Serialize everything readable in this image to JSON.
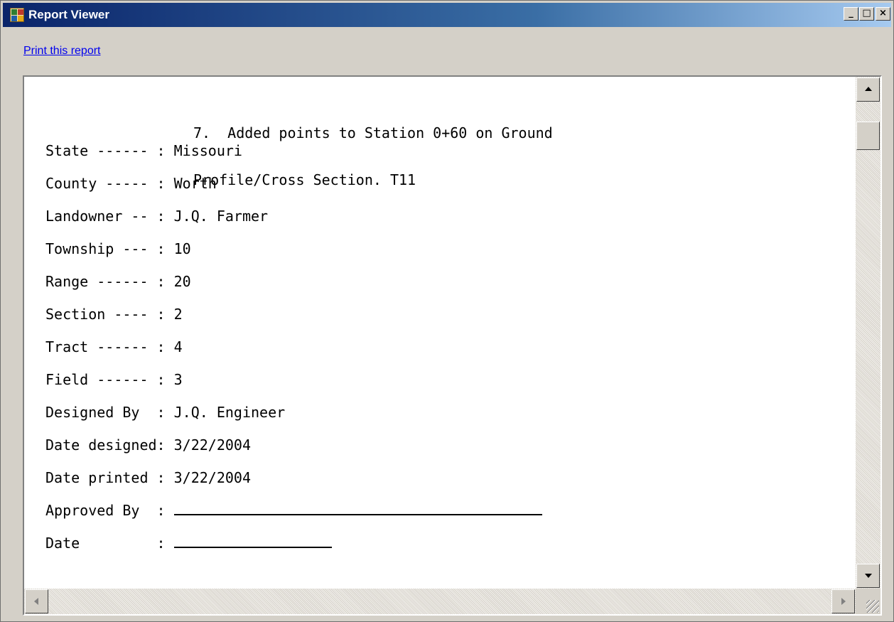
{
  "window": {
    "title": "Report Viewer",
    "controls": {
      "minimize": "_",
      "maximize": "□",
      "close": "×"
    }
  },
  "toolbar": {
    "print_link": "Print this report"
  },
  "report": {
    "note_line1": "7.  Added points to Station 0+60 on Ground",
    "note_line2": "Profile/Cross Section. T11",
    "fields": [
      {
        "label": "State ------ : ",
        "value": "Missouri"
      },
      {
        "label": "County ----- : ",
        "value": "Worth"
      },
      {
        "label": "Landowner -- : ",
        "value": "J.Q. Farmer"
      },
      {
        "label": "Township --- : ",
        "value": "10"
      },
      {
        "label": "Range ------ : ",
        "value": "20"
      },
      {
        "label": "Section ---- : ",
        "value": "2"
      },
      {
        "label": "Tract ------ : ",
        "value": "4"
      },
      {
        "label": "Field ------ : ",
        "value": "3"
      },
      {
        "label": "Designed By  : ",
        "value": "J.Q. Engineer"
      },
      {
        "label": "Date designed: ",
        "value": "3/22/2004"
      },
      {
        "label": "Date printed : ",
        "value": "3/22/2004"
      }
    ],
    "approved_label": "Approved By  : ",
    "date_label": "Date         : "
  }
}
